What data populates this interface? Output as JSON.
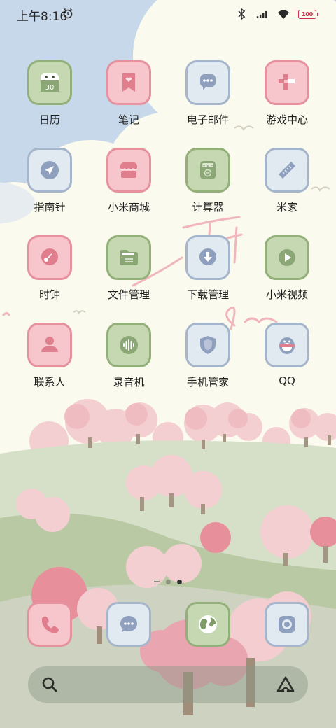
{
  "status_bar": {
    "time": "上午8:16",
    "icons": [
      "alarm-icon",
      "bluetooth-icon",
      "signal-icon",
      "wifi-icon"
    ],
    "battery_level": "100"
  },
  "apps": [
    {
      "label": "日历",
      "icon": "calendar-icon",
      "color": "green",
      "calendar_day": "30"
    },
    {
      "label": "笔记",
      "icon": "notes-icon",
      "color": "pink"
    },
    {
      "label": "电子邮件",
      "icon": "email-icon",
      "color": "blue"
    },
    {
      "label": "游戏中心",
      "icon": "game-center-icon",
      "color": "pink"
    },
    {
      "label": "指南针",
      "icon": "compass-icon",
      "color": "blue"
    },
    {
      "label": "小米商城",
      "icon": "mi-store-icon",
      "color": "pink"
    },
    {
      "label": "计算器",
      "icon": "calculator-icon",
      "color": "green"
    },
    {
      "label": "米家",
      "icon": "mi-home-icon",
      "color": "blue"
    },
    {
      "label": "时钟",
      "icon": "clock-icon",
      "color": "pink"
    },
    {
      "label": "文件管理",
      "icon": "file-manager-icon",
      "color": "green"
    },
    {
      "label": "下载管理",
      "icon": "download-icon",
      "color": "blue"
    },
    {
      "label": "小米视频",
      "icon": "video-icon",
      "color": "green"
    },
    {
      "label": "联系人",
      "icon": "contacts-icon",
      "color": "pink"
    },
    {
      "label": "录音机",
      "icon": "recorder-icon",
      "color": "green"
    },
    {
      "label": "手机管家",
      "icon": "security-icon",
      "color": "blue"
    },
    {
      "label": "QQ",
      "icon": "qq-icon",
      "color": "blue"
    }
  ],
  "page_indicator": {
    "pages": 2,
    "active": 2
  },
  "dock": [
    {
      "icon": "phone-icon",
      "color": "pink"
    },
    {
      "icon": "messages-icon",
      "color": "blue"
    },
    {
      "icon": "browser-icon",
      "color": "green"
    },
    {
      "icon": "camera-icon",
      "color": "blue"
    }
  ],
  "search_bar": {
    "left_icon": "search-icon",
    "right_icon": "assistant-icon"
  },
  "colors": {
    "green_fill": "#c6d8b1",
    "green_border": "#94b07a",
    "pink_fill": "#f7c5cc",
    "pink_border": "#e6919e",
    "blue_fill": "#e1e9f1",
    "blue_border": "#a5b6cc",
    "glyph_green": "#8aa775",
    "glyph_pink": "#e07e8e",
    "glyph_blue": "#8f9fbe"
  }
}
